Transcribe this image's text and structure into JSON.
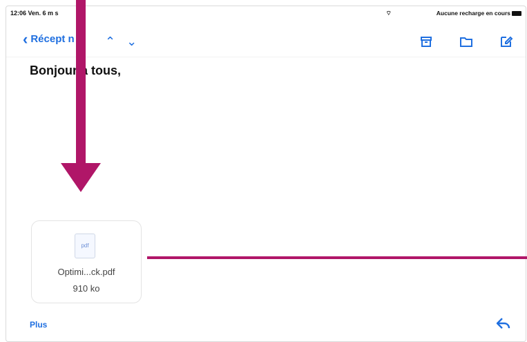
{
  "status_bar": {
    "time": "12:06 Ven. 6 m s",
    "wifi": "⌔",
    "charging": "Aucune recharge en cours"
  },
  "nav": {
    "back_label": "Récept n",
    "up_label": "⌃",
    "down_label": "⌄"
  },
  "message": {
    "greeting": "Bonjour a tous,"
  },
  "attachment": {
    "type": "pdf",
    "filename": "Optimi...ck.pdf",
    "size": "910 ko"
  },
  "footer": {
    "more_label": "Plus"
  },
  "colors": {
    "accent": "#1f6fe0",
    "annotation": "#b01668"
  },
  "icons": {
    "back": "chevron-left-icon",
    "up": "chevron-up-icon",
    "down": "chevron-down-icon",
    "archive": "archive-icon",
    "folder": "folder-icon",
    "compose": "compose-icon",
    "reply": "reply-icon",
    "file": "pdf-file-icon"
  }
}
